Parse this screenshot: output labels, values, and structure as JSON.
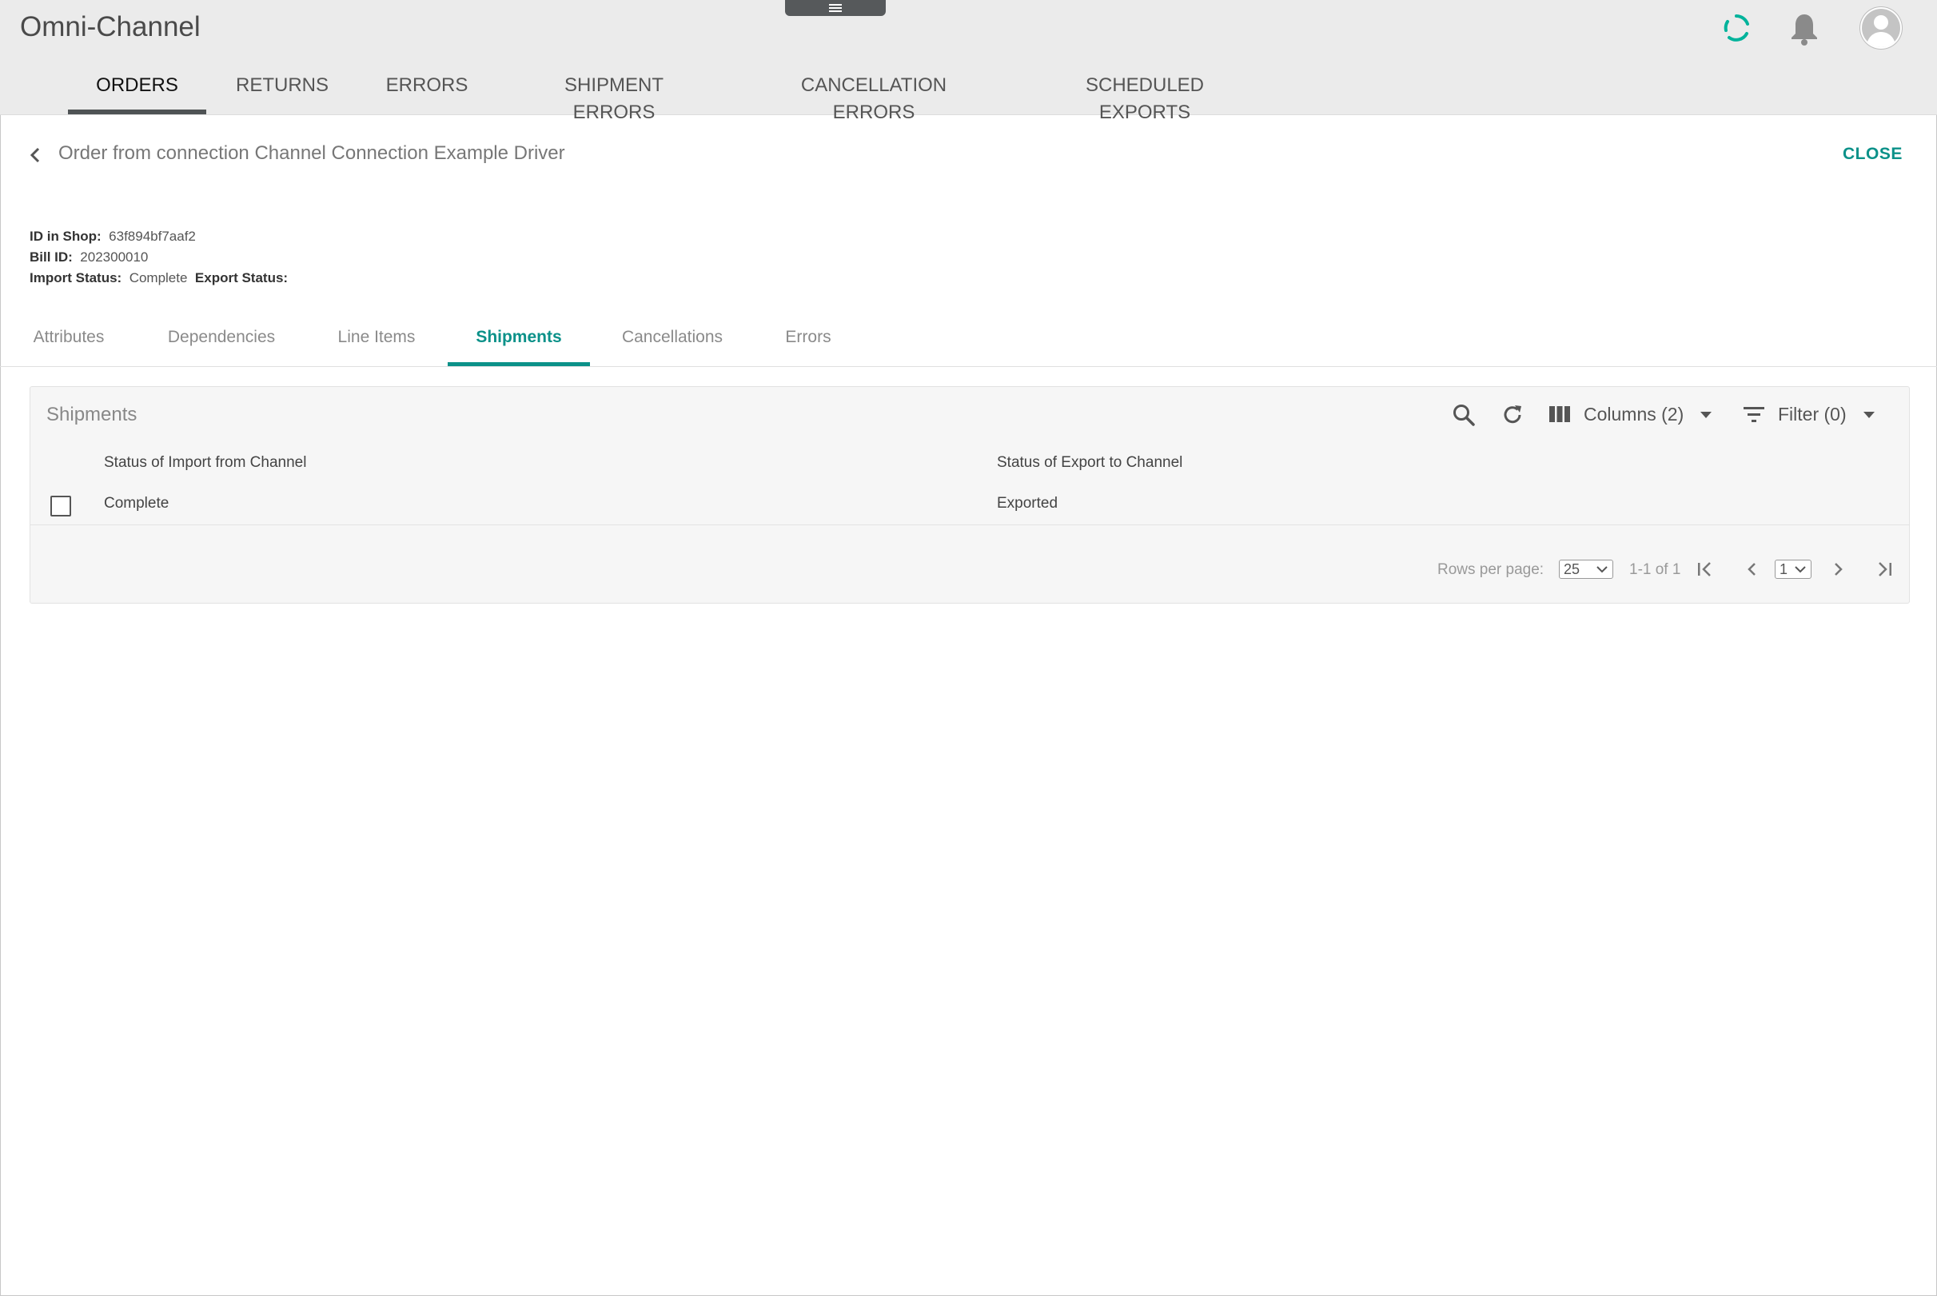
{
  "header": {
    "app_title": "Omni-Channel",
    "main_tabs": [
      {
        "label": "ORDERS",
        "active": true
      },
      {
        "label": "RETURNS",
        "active": false
      },
      {
        "label": "ERRORS",
        "active": false
      },
      {
        "label": "SHIPMENT ERRORS",
        "active": false
      },
      {
        "label": "CANCELLATION ERRORS",
        "active": false
      },
      {
        "label": "SCHEDULED EXPORTS",
        "active": false
      }
    ],
    "icons": [
      "menu-handle-icon",
      "loading-spinner-icon",
      "bell-icon",
      "user-avatar-icon"
    ],
    "accent_color": "#00b39b"
  },
  "detail": {
    "title": "Order from connection Channel Connection Example Driver",
    "close_label": "CLOSE",
    "meta": {
      "id_in_shop_label": "ID in Shop:",
      "id_in_shop_value": "63f894bf7aaf2",
      "bill_id_label": "Bill ID:",
      "bill_id_value": "202300010",
      "import_status_label": "Import Status:",
      "import_status_value": "Complete",
      "export_status_label": "Export Status:",
      "export_status_value": ""
    },
    "sub_tabs": [
      {
        "label": "Attributes",
        "active": false
      },
      {
        "label": "Dependencies",
        "active": false
      },
      {
        "label": "Line Items",
        "active": false
      },
      {
        "label": "Shipments",
        "active": true
      },
      {
        "label": "Cancellations",
        "active": false
      },
      {
        "label": "Errors",
        "active": false
      }
    ]
  },
  "shipments": {
    "title": "Shipments",
    "columns_label": "Columns (2)",
    "filter_label": "Filter (0)",
    "headers": [
      "Status of Import from Channel",
      "Status of Export to Channel"
    ],
    "rows": [
      {
        "import_status": "Complete",
        "export_status": "Exported",
        "checked": false
      }
    ],
    "pagination": {
      "rows_per_page_label": "Rows per page:",
      "rows_per_page": "25",
      "range": "1-1 of 1",
      "page": "1"
    }
  },
  "colors": {
    "brand_teal": "#0b9189",
    "header_bg": "#ebebeb",
    "active_tab_bar": "#4f5355"
  }
}
